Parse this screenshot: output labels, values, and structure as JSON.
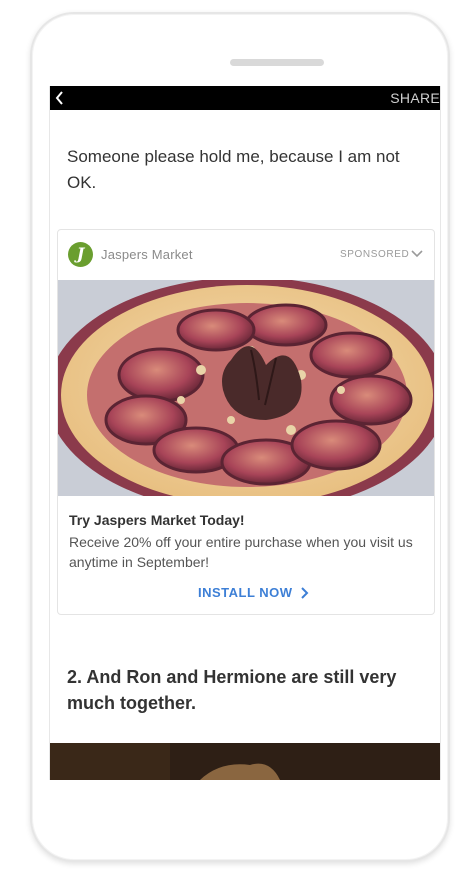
{
  "topbar": {
    "back_icon": "chevron-left-icon",
    "share_label": "SHARE"
  },
  "article": {
    "intro_text": "Someone please hold me, because I am not OK.",
    "heading2": "2. And Ron and Hermione are still very much together."
  },
  "ad": {
    "brand_name": "Jaspers Market",
    "brand_initial": "J",
    "sponsored_label": "SPONSORED",
    "menu_icon": "chevron-down-icon",
    "image": "fig-tart-photo",
    "title": "Try Jaspers Market Today!",
    "description": "Receive 20% off your entire purchase when you visit us anytime in September!",
    "cta_label": "INSTALL NOW",
    "cta_icon": "chevron-right-icon"
  },
  "colors": {
    "accent": "#3d7fd6",
    "brand_logo": "#6a9e2f",
    "topbar": "#000000",
    "text": "#333333"
  }
}
